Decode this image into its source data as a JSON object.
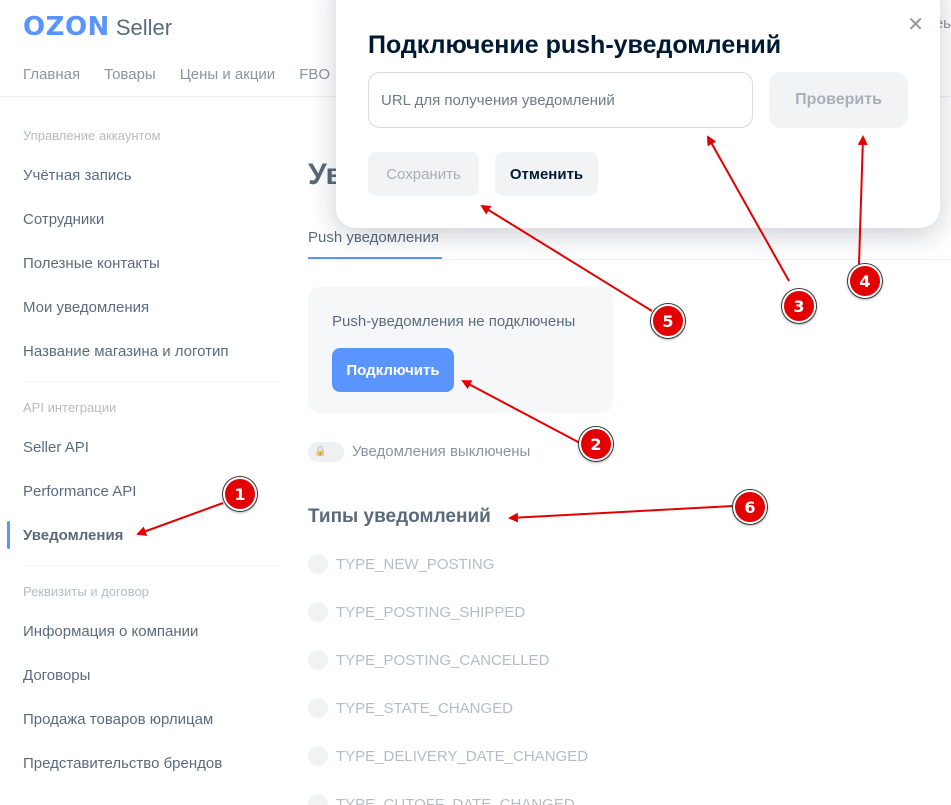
{
  "header": {
    "logo_brand": "OZON",
    "logo_suffix": "Seller",
    "nav": [
      "Главная",
      "Товары",
      "Цены и акции",
      "FBO"
    ],
    "right_partial": "чеь"
  },
  "sidebar": {
    "sections": [
      {
        "title": "Управление аккаунтом",
        "items": [
          "Учётная запись",
          "Сотрудники",
          "Полезные контакты",
          "Мои уведомления",
          "Название магазина и логотип"
        ]
      },
      {
        "title": "API интеграции",
        "items": [
          "Seller API",
          "Performance API",
          "Уведомления"
        ]
      },
      {
        "title": "Реквизиты и договор",
        "items": [
          "Информация о компании",
          "Договоры",
          "Продажа товаров юрлицам",
          "Представительство брендов"
        ]
      }
    ],
    "active_item": "Уведомления"
  },
  "main": {
    "page_title_partial": "Ув",
    "tab": "Push уведомления",
    "push_card": {
      "status_text": "Push-уведомления не подключены",
      "connect_label": "Подключить"
    },
    "toggle_label": "Уведомления выключены",
    "types_title": "Типы уведомлений",
    "types": [
      "TYPE_NEW_POSTING",
      "TYPE_POSTING_SHIPPED",
      "TYPE_POSTING_CANCELLED",
      "TYPE_STATE_CHANGED",
      "TYPE_DELIVERY_DATE_CHANGED",
      "TYPE_CUTOFF_DATE_CHANGED"
    ]
  },
  "modal": {
    "title": "Подключение push-уведомлений",
    "url_placeholder": "URL для получения уведомлений",
    "url_value": "",
    "check_label": "Проверить",
    "save_label": "Сохранить",
    "cancel_label": "Отменить",
    "close_glyph": "✕"
  },
  "annotations": [
    "1",
    "2",
    "3",
    "4",
    "5",
    "6"
  ],
  "colors": {
    "brand_blue": "#005bff",
    "annotation_red": "#e30000"
  }
}
